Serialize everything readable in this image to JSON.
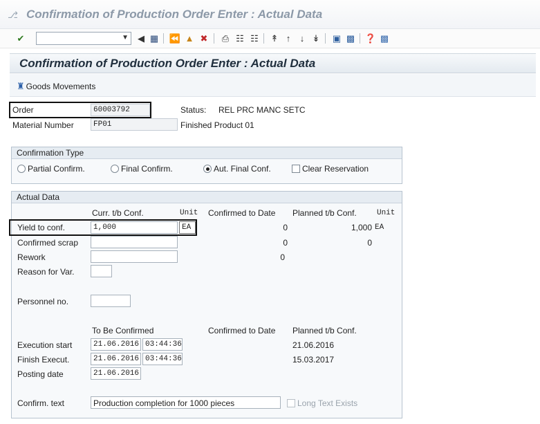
{
  "window": {
    "title": "Confirmation of Production Order Enter : Actual Data"
  },
  "toolbar": {
    "command_value": ""
  },
  "screen": {
    "title": "Confirmation of Production Order Enter : Actual Data"
  },
  "app_toolbar": {
    "goods_movements": "Goods Movements"
  },
  "order": {
    "order_label": "Order",
    "order_value": "60003792",
    "status_label": "Status:",
    "status_value": "REL  PRC  MANC SETC",
    "material_label": "Material Number",
    "material_value": "FP01",
    "material_desc": "Finished Product 01"
  },
  "confirmation_type": {
    "title": "Confirmation Type",
    "options": [
      "Partial Confirm.",
      "Final Confirm.",
      "Aut. Final Conf."
    ],
    "selected": "Aut. Final Conf.",
    "clear_reservation": "Clear Reservation"
  },
  "actual_data": {
    "title": "Actual Data",
    "col_curr": "Curr. t/b Conf.",
    "col_unit": "Unit",
    "col_confirmed": "Confirmed to Date",
    "col_planned": "Planned t/b Conf.",
    "col_unit2": "Unit",
    "yield_label": "Yield to conf.",
    "yield_value": "1,000",
    "yield_unit": "EA",
    "yield_confirmed": "0",
    "yield_planned": "1,000",
    "yield_planned_unit": "EA",
    "scrap_label": "Confirmed scrap",
    "scrap_value": "",
    "scrap_confirmed": "0",
    "scrap_planned": "0",
    "rework_label": "Rework",
    "rework_value": "",
    "rework_confirmed": "0",
    "reason_label": "Reason for Var.",
    "reason_value": "",
    "personnel_label": "Personnel no.",
    "personnel_value": "",
    "col_to_be": "To Be Confirmed",
    "col_confirmed2": "Confirmed to Date",
    "col_planned2": "Planned t/b Conf.",
    "exec_start_label": "Execution start",
    "exec_start_date": "21.06.2016",
    "exec_start_time": "03:44:36",
    "exec_start_planned": "21.06.2016",
    "finish_label": "Finish Execut.",
    "finish_date": "21.06.2016",
    "finish_time": "03:44:36",
    "finish_planned": "15.03.2017",
    "posting_label": "Posting date",
    "posting_date": "21.06.2016",
    "confirm_text_label": "Confirm. text",
    "confirm_text_value": "Production completion for 1000 pieces",
    "long_text": "Long Text Exists"
  }
}
